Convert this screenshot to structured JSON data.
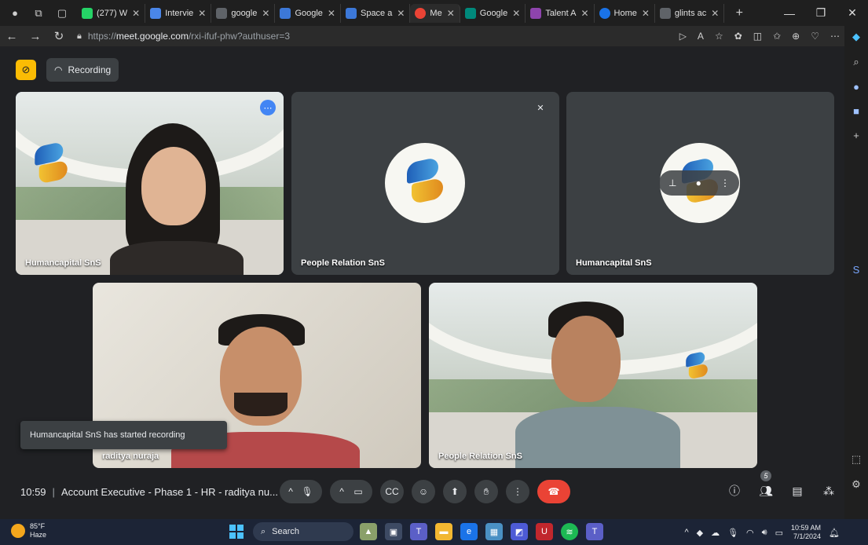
{
  "browser": {
    "tabs": [
      {
        "label": "(277) W",
        "color": "#25d366"
      },
      {
        "label": "Intervie",
        "color": "#4a86e8"
      },
      {
        "label": "google",
        "color": "#5f6368"
      },
      {
        "label": "Google",
        "color": "#3c78d8"
      },
      {
        "label": "Space a",
        "color": "#3c78d8"
      },
      {
        "label": "Me",
        "color": "#ea4335"
      },
      {
        "label": "Google",
        "color": "#00897b"
      },
      {
        "label": "Talent A",
        "color": "#8e44ad"
      },
      {
        "label": "Home",
        "color": "#1a73e8"
      },
      {
        "label": "glints ac",
        "color": "#5f6368"
      }
    ],
    "url_prefix": "https://",
    "url_domain": "meet.google.com",
    "url_path": "/rxi-ifuf-phw?authuser=3"
  },
  "meet": {
    "recording_label": "Recording",
    "tiles": [
      {
        "name": "Humancapital SnS"
      },
      {
        "name": "People Relation SnS"
      },
      {
        "name": "Humancapital SnS"
      },
      {
        "name": "raditya nuraja"
      },
      {
        "name": "People Relation SnS"
      }
    ],
    "toast": "Humancapital SnS has started recording",
    "time": "10:59",
    "meeting_title": "Account Executive - Phase 1 - HR - raditya nu...",
    "participant_count": "5",
    "colors": {
      "end_call": "#ea4335",
      "accent": "#8ab4f8",
      "recording_badge": "#fbbc04"
    }
  },
  "taskbar": {
    "weather_temp": "85°F",
    "weather_cond": "Haze",
    "weather_badge": "1",
    "search_label": "Search",
    "clock_time": "10:59 AM",
    "clock_date": "7/1/2024"
  }
}
